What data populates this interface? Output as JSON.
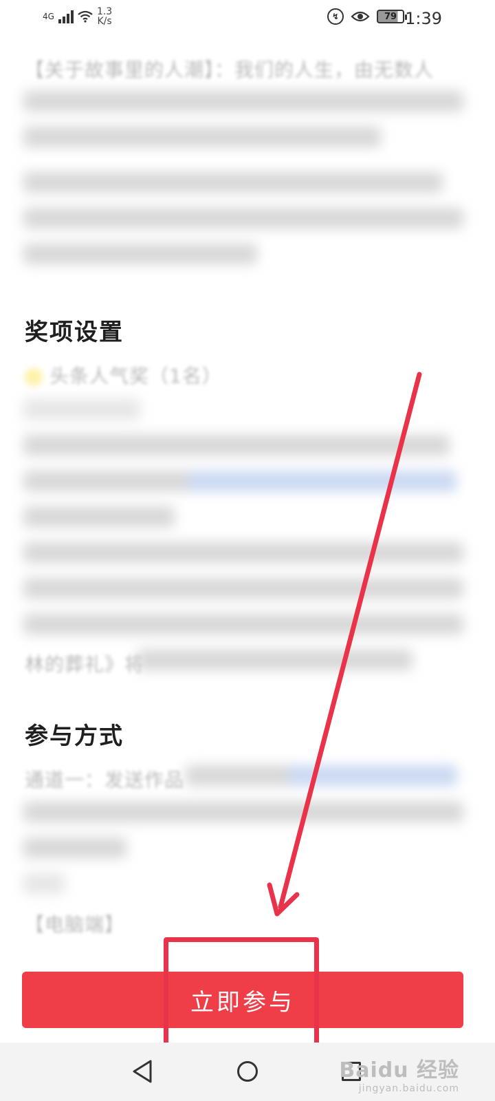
{
  "status_bar": {
    "network": "4G",
    "speed_value": "1.3",
    "speed_unit": "K/s",
    "battery": "79",
    "time": "1:39"
  },
  "article": {
    "intro_partial": "【关于故事里的人潮】：我们的人生，由无数人",
    "section_awards": "奖项设置",
    "award_item_partial": "头条人气奖（1名）",
    "body_partial": "林的葬礼》将",
    "section_participate": "参与方式",
    "channel_partial": "通道一：发送作品",
    "pc_partial": "【电脑端】"
  },
  "cta": {
    "label": "立即参与"
  },
  "watermark": {
    "main": "Baidu 经验",
    "sub": "jingyan.baidu.com"
  },
  "colors": {
    "cta": "#ef3e47",
    "annotation": "#e8334a"
  }
}
